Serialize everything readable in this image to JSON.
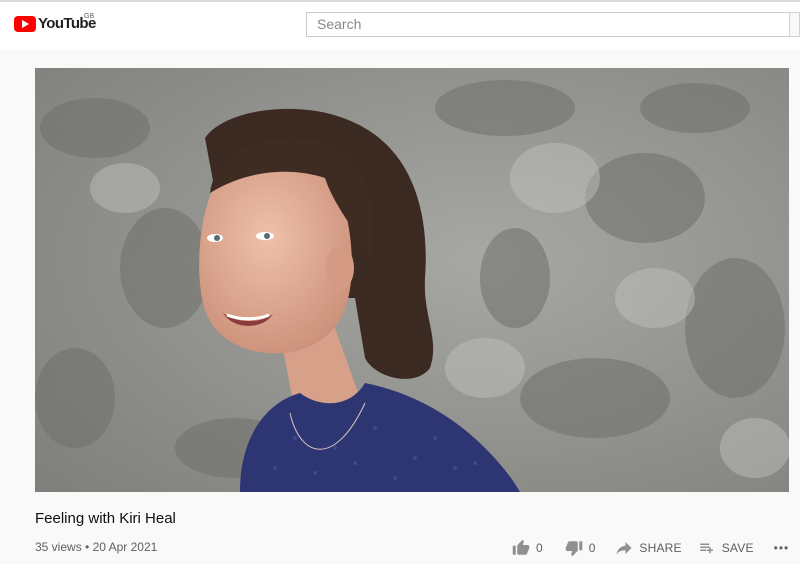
{
  "header": {
    "logo_text": "YouTube",
    "country_code": "GB",
    "search_placeholder": "Search"
  },
  "video": {
    "title": "Feeling with Kiri Heal",
    "views": "35 views",
    "date": "20 Apr 2021"
  },
  "actions": {
    "like_count": "0",
    "dislike_count": "0",
    "share_label": "SHARE",
    "save_label": "SAVE",
    "more_label": "•••"
  },
  "colors": {
    "brand": "#ff0000",
    "background": "#f9f9f9",
    "text_secondary": "#606060"
  },
  "icons": [
    "youtube-logo-icon",
    "thumbs-up-icon",
    "thumbs-down-icon",
    "share-icon",
    "save-playlist-icon",
    "more-icon"
  ]
}
